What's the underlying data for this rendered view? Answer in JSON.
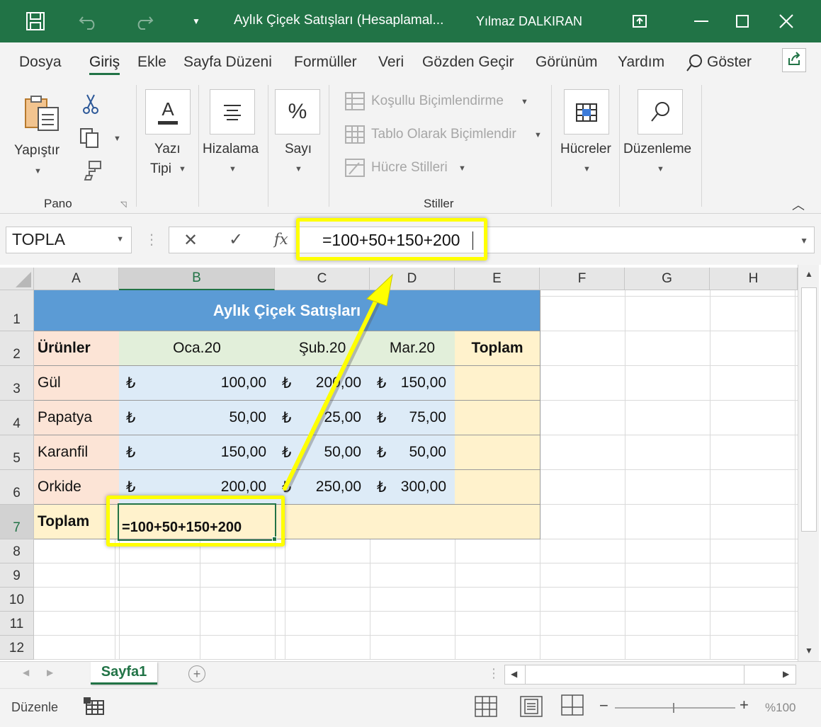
{
  "window": {
    "title": "Aylık Çiçek Satışları (Hesaplamal...",
    "user": "Yılmaz DALKIRAN"
  },
  "menu": {
    "tabs": [
      "Dosya",
      "Giriş",
      "Ekle",
      "Sayfa Düzeni",
      "Formüller",
      "Veri",
      "Gözden Geçir",
      "Görünüm",
      "Yardım"
    ],
    "active": "Giriş",
    "search_label": "Göster"
  },
  "ribbon": {
    "paste_label": "Yapıştır",
    "clipboard_group": "Pano",
    "font_label_1": "Yazı",
    "font_label_2": "Tipi",
    "font_icon_glyph": "A",
    "alignment_label": "Hizalama",
    "number_label": "Sayı",
    "number_icon_glyph": "%",
    "conditional_label": "Koşullu Biçimlendirme",
    "format_table_label": "Tablo Olarak Biçimlendir",
    "cell_styles_label": "Hücre Stilleri",
    "styles_group": "Stiller",
    "cells_label": "Hücreler",
    "editing_label": "Düzenleme"
  },
  "formula_bar": {
    "name_box": "TOPLA",
    "cancel_glyph": "✕",
    "enter_glyph": "✓",
    "fx_label": "fx",
    "formula": "=100+50+150+200"
  },
  "sheet": {
    "columns": [
      "A",
      "B",
      "C",
      "D",
      "E",
      "F",
      "G",
      "H"
    ],
    "rows": [
      "1",
      "2",
      "3",
      "4",
      "5",
      "6",
      "7",
      "8",
      "9",
      "10",
      "11",
      "12"
    ],
    "selected_column": "B",
    "selected_row": "7",
    "title": "Aylık Çiçek Satışları",
    "headers": [
      "Ürünler",
      "Oca.20",
      "Şub.20",
      "Mar.20",
      "Toplam"
    ],
    "currency_symbol": "₺",
    "products": [
      {
        "name": "Gül",
        "values": [
          "100,00",
          "200,00",
          "150,00"
        ]
      },
      {
        "name": "Papatya",
        "values": [
          "50,00",
          "25,00",
          "75,00"
        ]
      },
      {
        "name": "Karanfil",
        "values": [
          "150,00",
          "50,00",
          "50,00"
        ]
      },
      {
        "name": "Orkide",
        "values": [
          "200,00",
          "250,00",
          "300,00"
        ]
      }
    ],
    "total_label": "Toplam",
    "editing_cell_text": "=100+50+150+200",
    "colors": {
      "title_bg": "#5B9BD5",
      "product_bg": "#FCE4D6",
      "month_header_bg": "#E2EFDA",
      "value_bg": "#DDEBF7",
      "total_bg": "#FFF2CC",
      "highlight": "#FFFF00",
      "accent": "#217346"
    }
  },
  "tabs": {
    "sheet_name": "Sayfa1",
    "add_glyph": "+"
  },
  "status": {
    "mode": "Düzenle",
    "zoom": "%100"
  }
}
